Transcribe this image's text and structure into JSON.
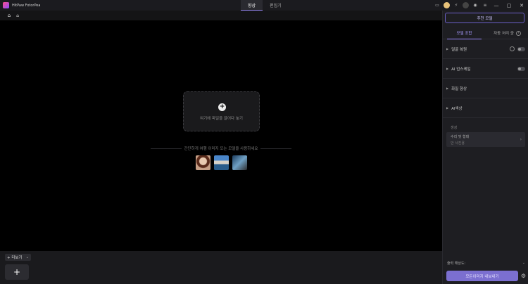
{
  "app": {
    "title": "HitPaw FotorPea"
  },
  "tabs": [
    {
      "label": "향상",
      "active": true
    },
    {
      "label": "편집기",
      "active": false
    }
  ],
  "titlebar_icons": [
    "feedback-icon",
    "gold-coin-icon",
    "lightning-icon",
    "dark-coin-icon",
    "account-icon",
    "menu-icon"
  ],
  "window_controls": {
    "minimize": "—",
    "maximize": "▢",
    "close": "✕"
  },
  "breadcrumb": {
    "home_icon": "⌂",
    "sub_icon": "⌂"
  },
  "canvas": {
    "plus": "+",
    "drop_text": "여기에 파일을 끌어다 놓기",
    "samples_label": "간단하게 여행 이미지 또는 모델을 사용하세요",
    "samples": [
      "portrait",
      "coastal-town",
      "sunset-beach"
    ]
  },
  "bottombar": {
    "more_label": "+ 더보기",
    "more_chev": "⌄",
    "add_label": "+"
  },
  "panel": {
    "recommend_label": "추천 모델",
    "tabs": [
      {
        "label": "모델 조합",
        "active": true
      },
      {
        "label": "자동 처리 중",
        "active": false,
        "help": "?"
      }
    ],
    "rows": [
      {
        "label": "얼굴 복원",
        "toggle": false,
        "extra_ring": true
      },
      {
        "label": "AI 업스케일",
        "toggle": false,
        "extra_ring": false
      },
      {
        "label": "화질 향상",
        "toggle": null,
        "extra_ring": false
      },
      {
        "label": "AI색상",
        "toggle": null,
        "extra_ring": false
      }
    ],
    "generate_label": "생성",
    "model_line1": "수리 및 형태",
    "model_line2": "안 사진용",
    "model_chev": "›",
    "resolution_label": "출력 해상도:",
    "resolution_chev": "⌄",
    "export_label": "모든이미지 내보내기",
    "settings_icon": "⚙"
  }
}
